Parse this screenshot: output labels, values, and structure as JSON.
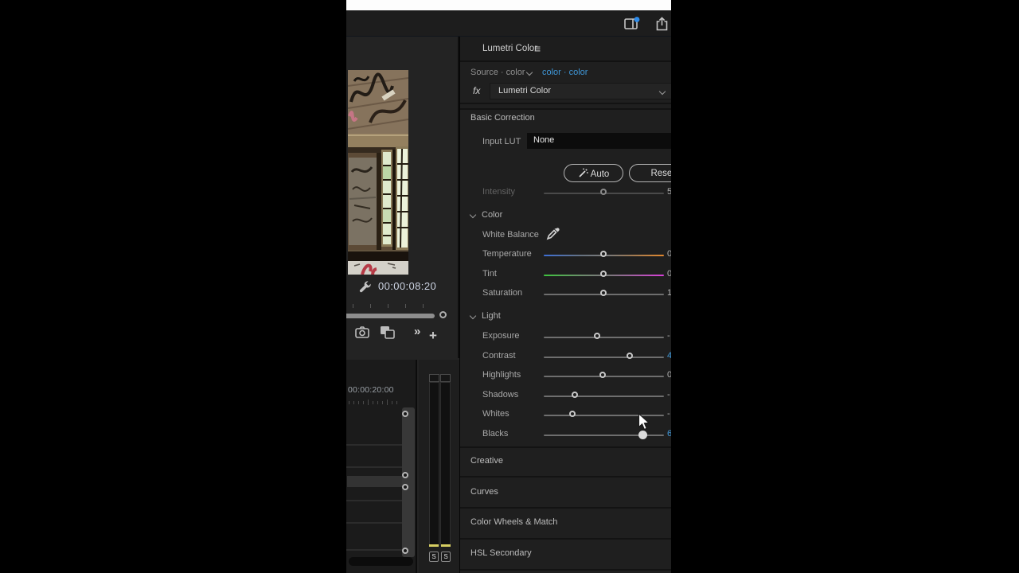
{
  "topbar": {
    "workspace_icon": "workspace-switcher-icon",
    "notification_dot_color": "#2d8ceb",
    "share_icon": "share-export-icon"
  },
  "program_monitor": {
    "timecode": "00:00:08:20",
    "wrench_icon": "wrench-settings-icon",
    "camera_icon": "export-frame-camera-icon",
    "compare_icon": "comparison-view-icon",
    "more_chevrons": "»",
    "add_button": "+"
  },
  "timeline": {
    "ruler_timecode": "00:00:20:00",
    "solo_buttons": [
      "S",
      "S"
    ]
  },
  "meters": {
    "level_color": "#d6ce62"
  },
  "panel": {
    "tab_title": "Lumetri Color",
    "menu_icon": "≡",
    "source_tab": "Source · color",
    "clip_tab": "color · color",
    "fx_badge": "fx",
    "effect_name": "Lumetri Color",
    "section_basic": "Basic Correction",
    "input_lut_label": "Input LUT",
    "input_lut_value": "None",
    "auto_button": "Auto",
    "reset_button": "Reset",
    "group_color": "Color",
    "group_light": "Light",
    "white_balance_label": "White Balance",
    "sliders": [
      {
        "label": "Intensity",
        "value": "5",
        "pos": 51,
        "gradient": "plain",
        "disabled": true
      },
      {
        "label": "Temperature",
        "value": "0",
        "pos": 51,
        "gradient": "temperature"
      },
      {
        "label": "Tint",
        "value": "0",
        "pos": 51,
        "gradient": "tint"
      },
      {
        "label": "Saturation",
        "value": "1",
        "pos": 51,
        "gradient": "plain"
      },
      {
        "label": "Exposure",
        "value": "-",
        "pos": 46,
        "gradient": "plain"
      },
      {
        "label": "Contrast",
        "value": "4",
        "pos": 73,
        "gradient": "plain",
        "value_blue": true
      },
      {
        "label": "Highlights",
        "value": "0",
        "pos": 50,
        "gradient": "plain"
      },
      {
        "label": "Shadows",
        "value": "-",
        "pos": 27,
        "gradient": "plain"
      },
      {
        "label": "Whites",
        "value": "-",
        "pos": 25,
        "gradient": "plain"
      },
      {
        "label": "Blacks",
        "value": "6",
        "pos": 83,
        "gradient": "plain",
        "filled": true,
        "value_blue": true
      }
    ],
    "collapsed_sections": [
      "Creative",
      "Curves",
      "Color Wheels & Match",
      "HSL Secondary"
    ],
    "accent_blue": "#3f97d8"
  }
}
